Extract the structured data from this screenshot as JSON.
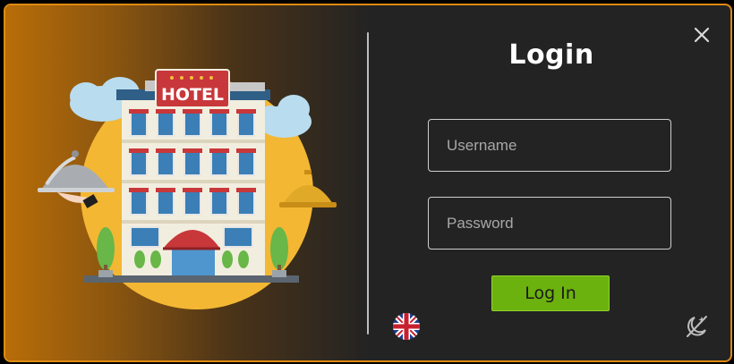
{
  "hotel_sign": "HOTEL",
  "login": {
    "title": "Login",
    "username_placeholder": "Username",
    "password_placeholder": "Password",
    "submit_label": "Log In"
  },
  "icons": {
    "close": "close-icon",
    "language": "uk-flag-icon",
    "theme": "dark-mode-toggle-icon"
  },
  "colors": {
    "accent_border": "#e08a12",
    "button": "#6cb20e",
    "panel": "#232323"
  }
}
